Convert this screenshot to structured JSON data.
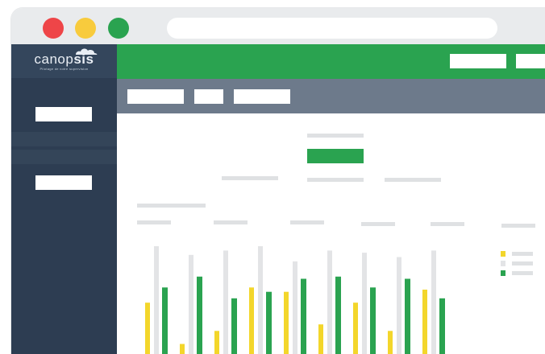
{
  "app": {
    "logo_text_regular": "canop",
    "logo_text_bold": "sis",
    "logo_tagline": "Pilotage de votre supervision"
  },
  "colors": {
    "brand_green": "#2aa350",
    "sidebar": "#2d3d52",
    "toolbar": "#6d7a8b",
    "bar_yellow": "#f3d62b",
    "bar_gray": "#e3e4e6"
  },
  "window_controls": [
    "close",
    "minimize",
    "maximize"
  ],
  "chart_data": {
    "type": "bar",
    "series": [
      {
        "values": [
          0.48,
          0.1,
          0.22,
          0.62,
          0.58,
          0.28,
          0.48,
          0.22,
          0.6
        ]
      },
      {
        "values": [
          1.0,
          0.92,
          0.96,
          1.0,
          0.86,
          0.96,
          0.94,
          0.9,
          0.96
        ]
      },
      {
        "values": [
          0.62,
          0.72,
          0.52,
          0.58,
          0.7,
          0.72,
          0.62,
          0.7,
          0.52
        ]
      }
    ],
    "ylim": [
      0,
      1
    ]
  }
}
